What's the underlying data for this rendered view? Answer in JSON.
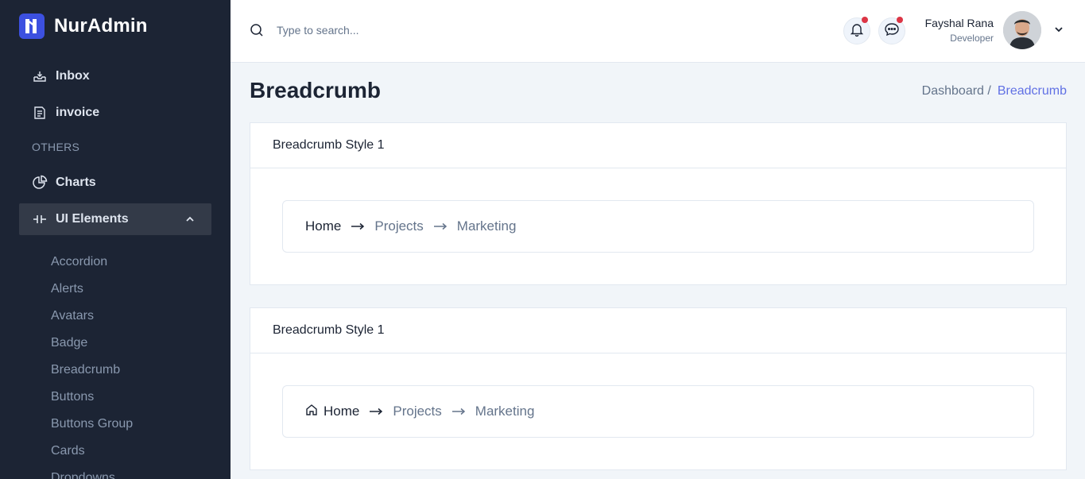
{
  "brand": {
    "name": "NurAdmin"
  },
  "sidebar": {
    "items": [
      {
        "label": "Inbox"
      },
      {
        "label": "invoice"
      }
    ],
    "section_label": "OTHERS",
    "other_items": [
      {
        "label": "Charts"
      },
      {
        "label": "UI Elements"
      }
    ],
    "sub_items": [
      {
        "label": "Accordion"
      },
      {
        "label": "Alerts"
      },
      {
        "label": "Avatars"
      },
      {
        "label": "Badge"
      },
      {
        "label": "Breadcrumb"
      },
      {
        "label": "Buttons"
      },
      {
        "label": "Buttons Group"
      },
      {
        "label": "Cards"
      },
      {
        "label": "Dropdowns"
      }
    ]
  },
  "header": {
    "search_placeholder": "Type to search...",
    "user_name": "Fayshal Rana",
    "user_role": "Developer"
  },
  "page": {
    "title": "Breadcrumb",
    "breadcrumb": [
      "Dashboard /",
      "Breadcrumb"
    ]
  },
  "cards": [
    {
      "title": "Breadcrumb Style 1",
      "crumbs": [
        "Home",
        "Projects",
        "Marketing"
      ],
      "home_icon": false
    },
    {
      "title": "Breadcrumb Style 1",
      "crumbs": [
        "Home",
        "Projects",
        "Marketing"
      ],
      "home_icon": true
    }
  ],
  "colors": {
    "sidebar_bg": "#1c2434",
    "primary": "#3c50e0",
    "notification_dot": "#dc3545"
  }
}
